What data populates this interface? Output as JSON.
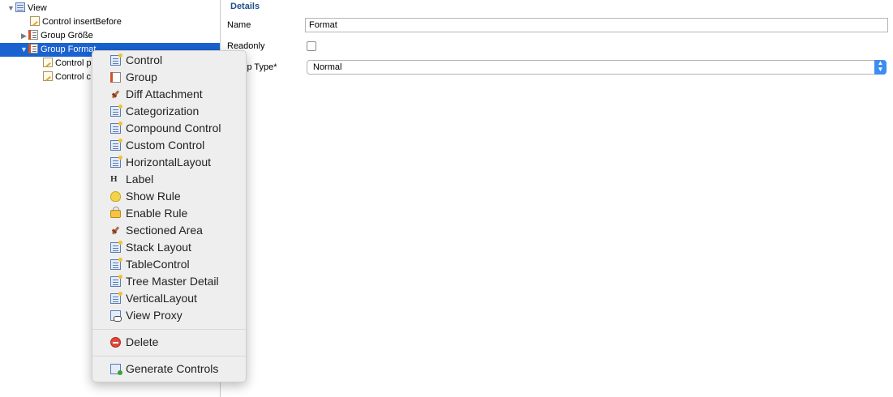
{
  "tree": {
    "items": [
      {
        "label": "View",
        "twisty": "▼",
        "icon": "view-icon"
      },
      {
        "label": "Control insertBefore",
        "twisty": "",
        "icon": "control-icon"
      },
      {
        "label": "Group Größe",
        "twisty": "▶",
        "icon": "group-icon"
      },
      {
        "label": "Group Format",
        "twisty": "▼",
        "icon": "group-icon"
      },
      {
        "label": "Control p",
        "twisty": "",
        "icon": "control-icon"
      },
      {
        "label": "Control c",
        "twisty": "",
        "icon": "control-icon"
      }
    ]
  },
  "details": {
    "title": "Details",
    "name_label": "Name",
    "name_value": "Format",
    "readonly_label": "Readonly",
    "group_type_label": "Group Type*",
    "group_type_value": "Normal"
  },
  "context_menu": {
    "items": [
      {
        "label": "Control",
        "icon": "control-icon"
      },
      {
        "label": "Group",
        "icon": "group-icon"
      },
      {
        "label": "Diff Attachment",
        "icon": "pin-icon"
      },
      {
        "label": "Categorization",
        "icon": "categorization-icon"
      },
      {
        "label": "Compound Control",
        "icon": "compound-control-icon"
      },
      {
        "label": "Custom Control",
        "icon": "custom-control-icon"
      },
      {
        "label": "HorizontalLayout",
        "icon": "horizontal-layout-icon"
      },
      {
        "label": "Label",
        "icon": "label-icon",
        "glyph": "H"
      },
      {
        "label": "Show Rule",
        "icon": "bulb-icon"
      },
      {
        "label": "Enable Rule",
        "icon": "lock-icon"
      },
      {
        "label": "Sectioned Area",
        "icon": "pin-icon"
      },
      {
        "label": "Stack Layout",
        "icon": "stack-layout-icon"
      },
      {
        "label": "TableControl",
        "icon": "table-control-icon"
      },
      {
        "label": "Tree Master Detail",
        "icon": "tree-master-detail-icon"
      },
      {
        "label": "VerticalLayout",
        "icon": "vertical-layout-icon"
      },
      {
        "label": "View Proxy",
        "icon": "view-proxy-icon"
      }
    ],
    "delete_label": "Delete",
    "generate_label": "Generate Controls"
  },
  "colors": {
    "selection": "#1a62d0",
    "details_title": "#1f4e8c",
    "select_accent": "#3d8cf1",
    "delete": "#e0473c"
  }
}
